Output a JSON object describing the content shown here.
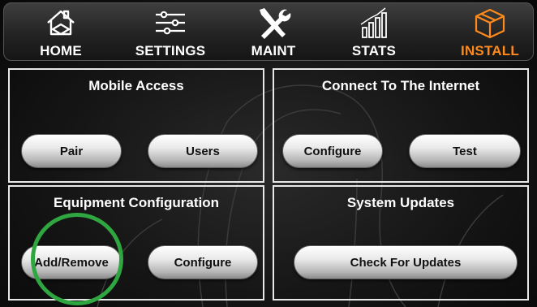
{
  "nav": {
    "tabs": [
      {
        "label": "HOME",
        "icon": "home-icon",
        "active": false
      },
      {
        "label": "SETTINGS",
        "icon": "sliders-icon",
        "active": false
      },
      {
        "label": "MAINT",
        "icon": "wrench-screwdriver-icon",
        "active": false
      },
      {
        "label": "STATS",
        "icon": "bar-chart-icon",
        "active": false
      },
      {
        "label": "INSTALL",
        "icon": "box-icon",
        "active": true
      }
    ],
    "active_color": "#ff8a1c"
  },
  "panels": {
    "mobile_access": {
      "title": "Mobile Access",
      "buttons": [
        "Pair",
        "Users"
      ]
    },
    "internet": {
      "title": "Connect To The Internet",
      "buttons": [
        "Configure",
        "Test"
      ]
    },
    "equipment": {
      "title": "Equipment Configuration",
      "buttons": [
        "Add/Remove",
        "Configure"
      ]
    },
    "updates": {
      "title": "System Updates",
      "buttons": [
        "Check For Updates"
      ]
    }
  },
  "highlight_color": "#2fa640"
}
